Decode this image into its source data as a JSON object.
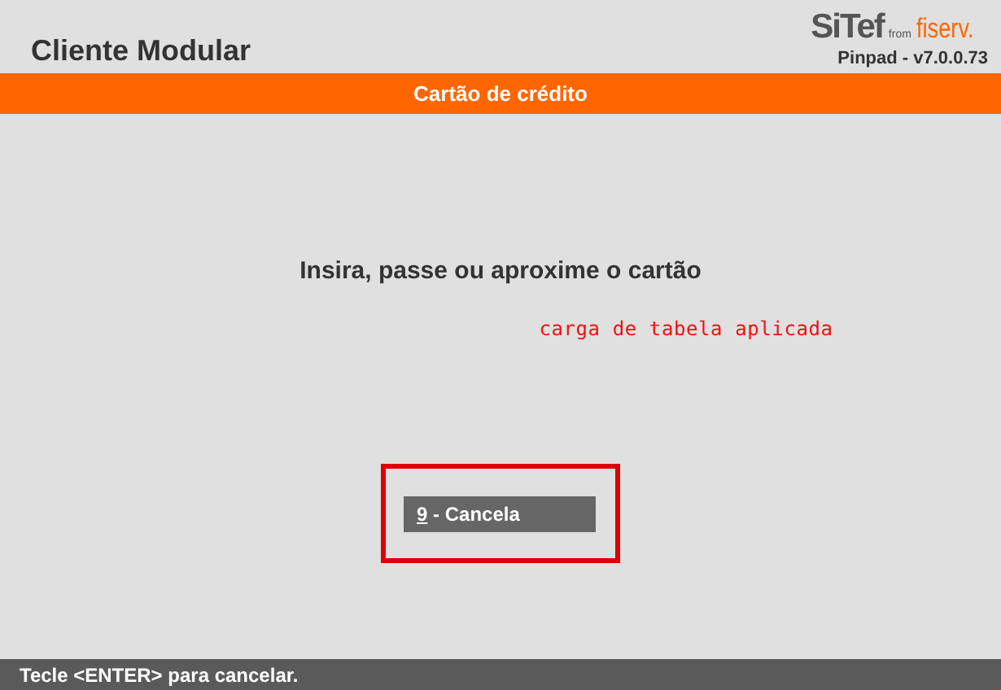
{
  "header": {
    "title": "Cliente Modular",
    "logo": {
      "brand": "SiTef",
      "from": "from",
      "partner": "fiserv."
    },
    "version": "Pinpad - v7.0.0.73"
  },
  "section_bar": {
    "title": "Cartão de crédito"
  },
  "prompt": "Insira, passe ou aproxime o cartão",
  "status_message": "carga de tabela aplicada",
  "buttons": [
    {
      "hotkey": "9",
      "label": " - Cancela",
      "highlighted": true
    }
  ],
  "status_bar": "Tecle <ENTER> para cancelar."
}
